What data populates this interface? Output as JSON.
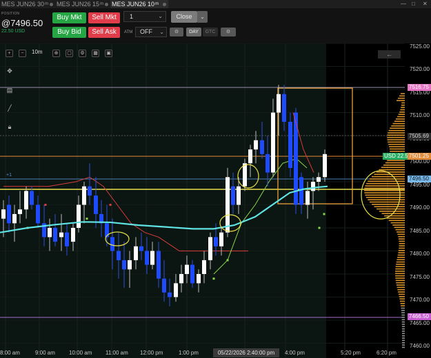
{
  "tabs": [
    {
      "label": "MES JUN26 30",
      "sup": "m",
      "active": false
    },
    {
      "label": "MES JUN26 15",
      "sup": "m",
      "active": false
    },
    {
      "label": "MES JUN26 10",
      "sup": "m",
      "active": true
    }
  ],
  "window_controls": {
    "minimize": "—",
    "maximize": "□",
    "close": "✕"
  },
  "order_bar": {
    "position_label": "POSITION",
    "position_price": "@7496.50",
    "position_usd": "22.50 USD",
    "buy_mkt": "Buy Mkt",
    "sell_mkt": "Sell Mkt",
    "buy_bid": "Buy Bid",
    "sell_ask": "Sell Ask",
    "quantity": "1",
    "close_label": "Close",
    "atm_label": "ATM",
    "atm_value": "OFF",
    "day_label": "DAY",
    "gtc_label": "GTC"
  },
  "chart_toolbar": {
    "timeframe": "10m",
    "plus_label": "+1"
  },
  "price_axis": {
    "labels": [
      "7525.00",
      "7520.00",
      "7515.00",
      "7510.00",
      "7505.00",
      "7500.00",
      "7495.00",
      "7490.00",
      "7485.00",
      "7480.00",
      "7475.00",
      "7470.00",
      "7465.00",
      "7460.00"
    ],
    "tags": [
      {
        "text": "7516.75",
        "bg": "#e875c4",
        "color": "#ffffff"
      },
      {
        "text": "7505.69",
        "bg": "#2a2a2a",
        "color": "#d8d8d8"
      },
      {
        "text": "USD 22.50",
        "bg": "#27ae60",
        "color": "#ffffff"
      },
      {
        "text": "7501.25",
        "bg": "#e38b3a",
        "color": "#ffffff"
      },
      {
        "text": "7496.50",
        "bg": "#7ab8e8",
        "color": "#0b1a2a"
      },
      {
        "text": "7466.50",
        "bg": "#c75fd1",
        "color": "#ffffff"
      }
    ]
  },
  "time_axis": {
    "labels": [
      "8:00 am",
      "9:00 am",
      "10:00 am",
      "11:00 am",
      "12:00 pm",
      "1:00 pm",
      "4:00 pm",
      "5:20 pm",
      "6:20 pm"
    ],
    "cursor": "05/22/2026 2:40:00 pm"
  },
  "colors": {
    "bull": "#ffffff",
    "bear": "#1f4bff",
    "ema": "#5fe3e3",
    "trail": "#d93c3c",
    "trail_up": "#8ad64a",
    "yellow": "#e9e04a",
    "orange": "#e9a23b",
    "profile_orange": "#e59a2a",
    "profile_gray": "#9a9a9a"
  }
}
